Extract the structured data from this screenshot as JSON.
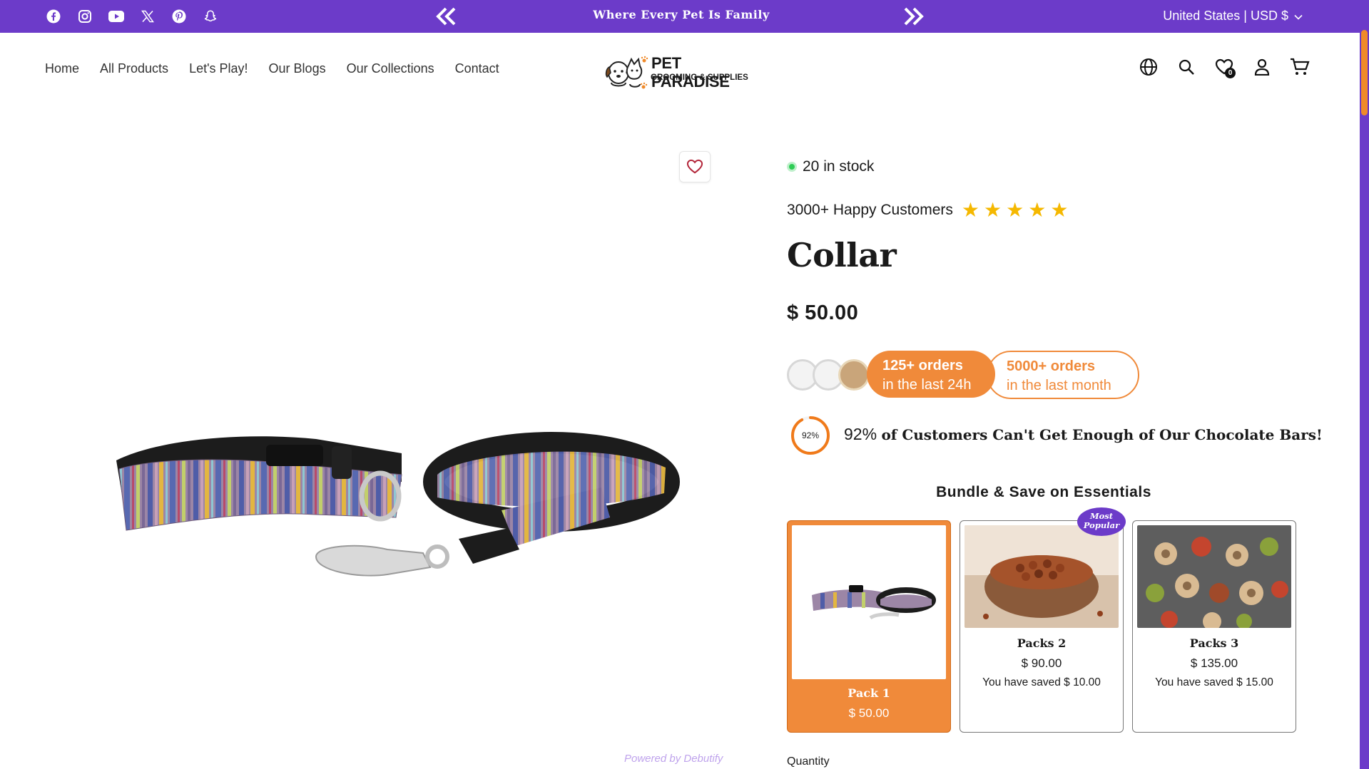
{
  "announcement": {
    "text": "Where Every Pet Is Family",
    "social_icons": [
      "facebook-icon",
      "instagram-icon",
      "youtube-icon",
      "x-icon",
      "pinterest-icon",
      "snapchat-icon"
    ],
    "locale": "United States | USD $"
  },
  "header": {
    "nav": [
      "Home",
      "All Products",
      "Let's Play!",
      "Our Blogs",
      "Our Collections",
      "Contact"
    ],
    "logo": {
      "brand": "PET PARADISE",
      "tagline": "GROOMING & SUPPLIES"
    },
    "wishlist_count": "0"
  },
  "gallery": {
    "powered_by": "Powered by Debutify"
  },
  "product": {
    "stock": "20 in stock",
    "happy_customers": "3000+ Happy Customers",
    "rating_stars": 5,
    "title": "Collar",
    "price": "$ 50.00",
    "orders_24h": {
      "count": "125+ orders",
      "period": "in the last 24h"
    },
    "orders_month": {
      "count": "5000+ orders",
      "period": "in the last month"
    },
    "satisfaction": {
      "ring_label": "92%",
      "value": "92%",
      "text": "of Customers Can't Get Enough of Our Chocolate Bars!"
    },
    "bundle_title": "Bundle & Save on Essentials",
    "bundles": [
      {
        "name": "Pack 1",
        "price": "$ 50.00",
        "saved": "",
        "selected": true
      },
      {
        "name": "Packs 2",
        "price": "$ 90.00",
        "saved": "You have saved $ 10.00",
        "selected": false
      },
      {
        "name": "Packs 3",
        "price": "$ 135.00",
        "saved": "You have saved $ 15.00",
        "selected": false
      }
    ],
    "badge": "Most Popular",
    "quantity_label": "Quantity"
  },
  "colors": {
    "brand_purple": "#6c3bc9",
    "accent_orange": "#f08a3a",
    "star_yellow": "#f5b800",
    "stock_green": "#2ecc55"
  }
}
